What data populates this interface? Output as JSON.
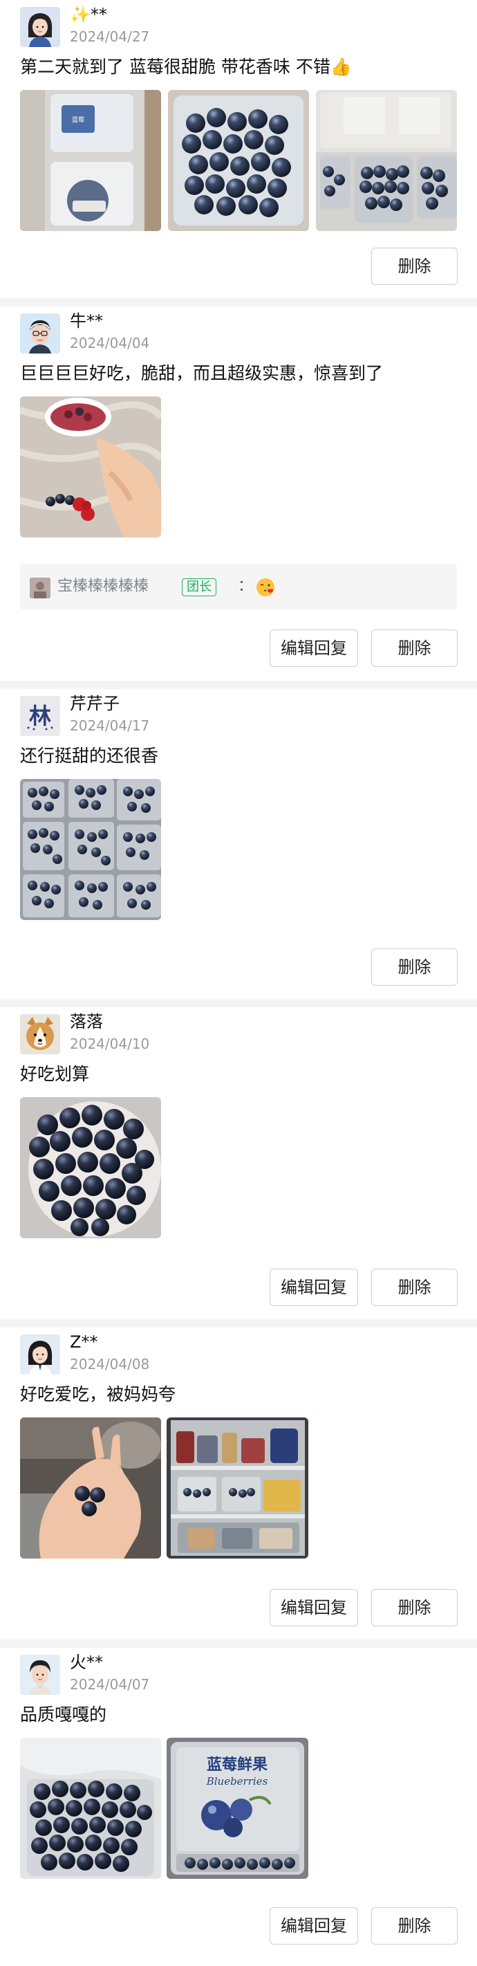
{
  "reviews": [
    {
      "user": "✨**",
      "date": "2024/04/27",
      "comment": "第二天就到了 蓝莓很甜脆 带花香味 不错👍",
      "photo_count": 3,
      "actions": {
        "delete": "删除"
      }
    },
    {
      "user": "牛**",
      "date": "2024/04/04",
      "comment": "巨巨巨巨好吃，脆甜，而且超级实惠，惊喜到了",
      "photo_count": 1,
      "reply": {
        "name": "宝榛榛榛榛榛",
        "badge": "团长",
        "colon": "：",
        "emoji": "😘"
      },
      "actions": {
        "edit_reply": "编辑回复",
        "delete": "删除"
      }
    },
    {
      "user": "芹芹子",
      "date": "2024/04/17",
      "comment": "还行挺甜的还很香",
      "photo_count": 1,
      "avatar_text": "林",
      "actions": {
        "delete": "删除"
      }
    },
    {
      "user": "落落",
      "date": "2024/04/10",
      "comment": "好吃划算",
      "photo_count": 1,
      "actions": {
        "edit_reply": "编辑回复",
        "delete": "删除"
      }
    },
    {
      "user": "Z**",
      "date": "2024/04/08",
      "comment": "好吃爱吃，被妈妈夸",
      "photo_count": 2,
      "actions": {
        "edit_reply": "编辑回复",
        "delete": "删除"
      }
    },
    {
      "user": "火**",
      "date": "2024/04/07",
      "comment": "品质嘎嘎的",
      "photo_count": 2,
      "package_label": {
        "cn": "蓝莓鲜果",
        "en": "Blueberries"
      },
      "actions": {
        "edit_reply": "编辑回复",
        "delete": "删除"
      }
    }
  ],
  "colors": {
    "accent_green": "#21b05d",
    "date_gray": "#9a9a9a",
    "divider": "#f4f4f4",
    "reply_bg": "#f5f5f5"
  },
  "icons": {
    "avatar_style": "cartoon-avatar",
    "reply_badge": "team-leader-badge",
    "reply_emoji": "blowing-kiss-emoji"
  }
}
